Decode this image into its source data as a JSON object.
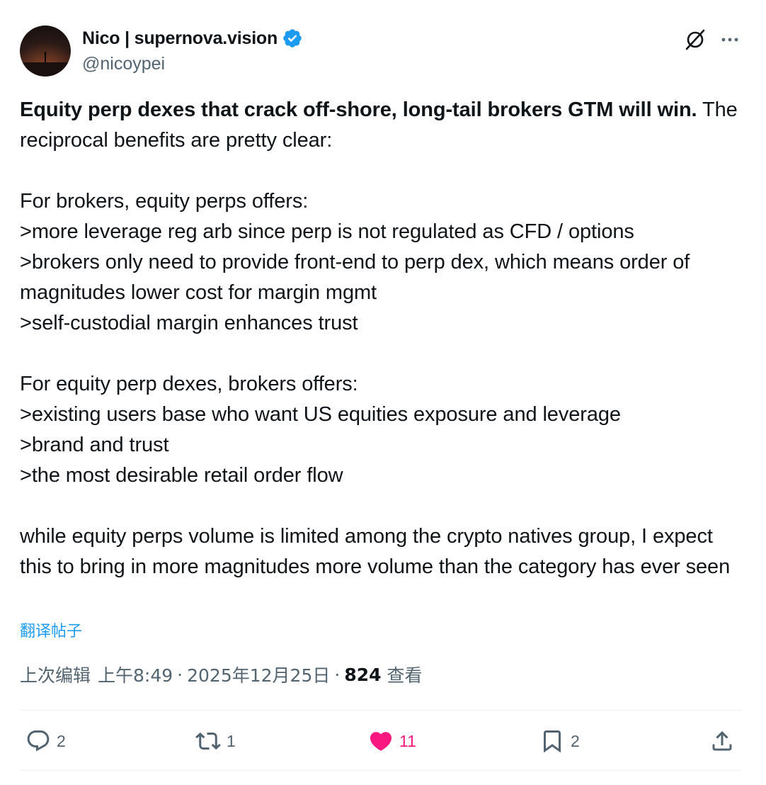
{
  "author": {
    "display_name": "Nico | supernova.vision",
    "handle": "@nicoypei",
    "verified": true,
    "verified_color": "#1d9bf0",
    "avatar_icon": "person-silhouette-sunset"
  },
  "post": {
    "bold_lead": "Equity perp dexes that crack off-shore, long-tail brokers GTM will win.",
    "body": " The reciprocal benefits are pretty clear:\n\nFor brokers, equity perps offers:\n>more leverage reg arb since perp is not regulated as CFD / options\n>brokers only need to provide front-end to perp dex, which means order of magnitudes lower cost for margin mgmt\n>self-custodial margin enhances trust\n\nFor equity perp dexes, brokers offers:\n>existing users base who want US equities exposure and leverage\n>brand and trust\n>the most desirable retail order flow\n\nwhile equity perps volume is limited among the crypto natives group, I expect this to bring in more magnitudes more volume than the category has ever seen",
    "translate_label": "翻译帖子"
  },
  "meta": {
    "edited_label": "上次编辑",
    "time": "上午8:49",
    "dot": "·",
    "date": "2025年12月25日",
    "views_count": "824",
    "views_label": "查看"
  },
  "actions": {
    "reply": {
      "icon": "reply-icon",
      "count": "2"
    },
    "retweet": {
      "icon": "retweet-icon",
      "count": "1"
    },
    "like": {
      "icon": "heart-icon",
      "count": "11",
      "active": true,
      "color": "#f91880"
    },
    "bookmark": {
      "icon": "bookmark-icon",
      "count": "2"
    },
    "share": {
      "icon": "share-icon"
    }
  },
  "header_icons": {
    "grok": "grok-icon",
    "more": "more-icon"
  },
  "colors": {
    "text": "#0f1419",
    "secondary": "#536471",
    "link": "#1d9bf0",
    "like": "#f91880",
    "divider": "#eff3f4"
  }
}
